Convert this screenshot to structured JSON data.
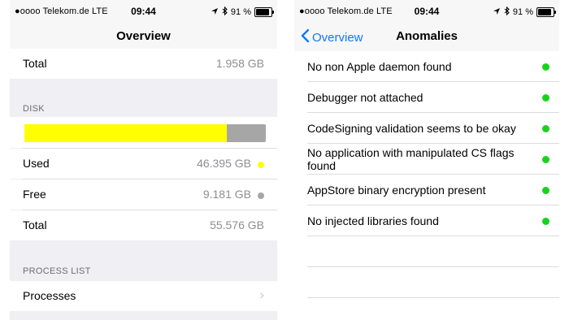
{
  "colors": {
    "accent": "#0a7aff",
    "used_dot": "#ffff00",
    "free_dot": "#a6a6a6",
    "status_ok": "#19d21d"
  },
  "left": {
    "status": {
      "carrier": "●oooo Telekom.de  LTE",
      "time": "09:44",
      "battery": "91 %"
    },
    "nav_title": "Overview",
    "top_total": {
      "label": "Total",
      "value": "1.958 GB"
    },
    "disk_header": "DISK",
    "disk_used_fraction": 0.84,
    "disk_rows": [
      {
        "label": "Used",
        "value": "46.395 GB",
        "dot": "yellow"
      },
      {
        "label": "Free",
        "value": "9.181 GB",
        "dot": "gray"
      },
      {
        "label": "Total",
        "value": "55.576 GB"
      }
    ],
    "process_header": "PROCESS LIST",
    "processes_label": "Processes"
  },
  "right": {
    "status": {
      "carrier": "●oooo Telekom.de  LTE",
      "time": "09:44",
      "battery": "91 %"
    },
    "back_label": "Overview",
    "nav_title": "Anomalies",
    "anomalies": [
      "No non Apple daemon found",
      "Debugger not attached",
      "CodeSigning validation seems to be okay",
      "No application with manipulated CS flags found",
      "AppStore binary encryption present",
      "No injected libraries found"
    ]
  }
}
